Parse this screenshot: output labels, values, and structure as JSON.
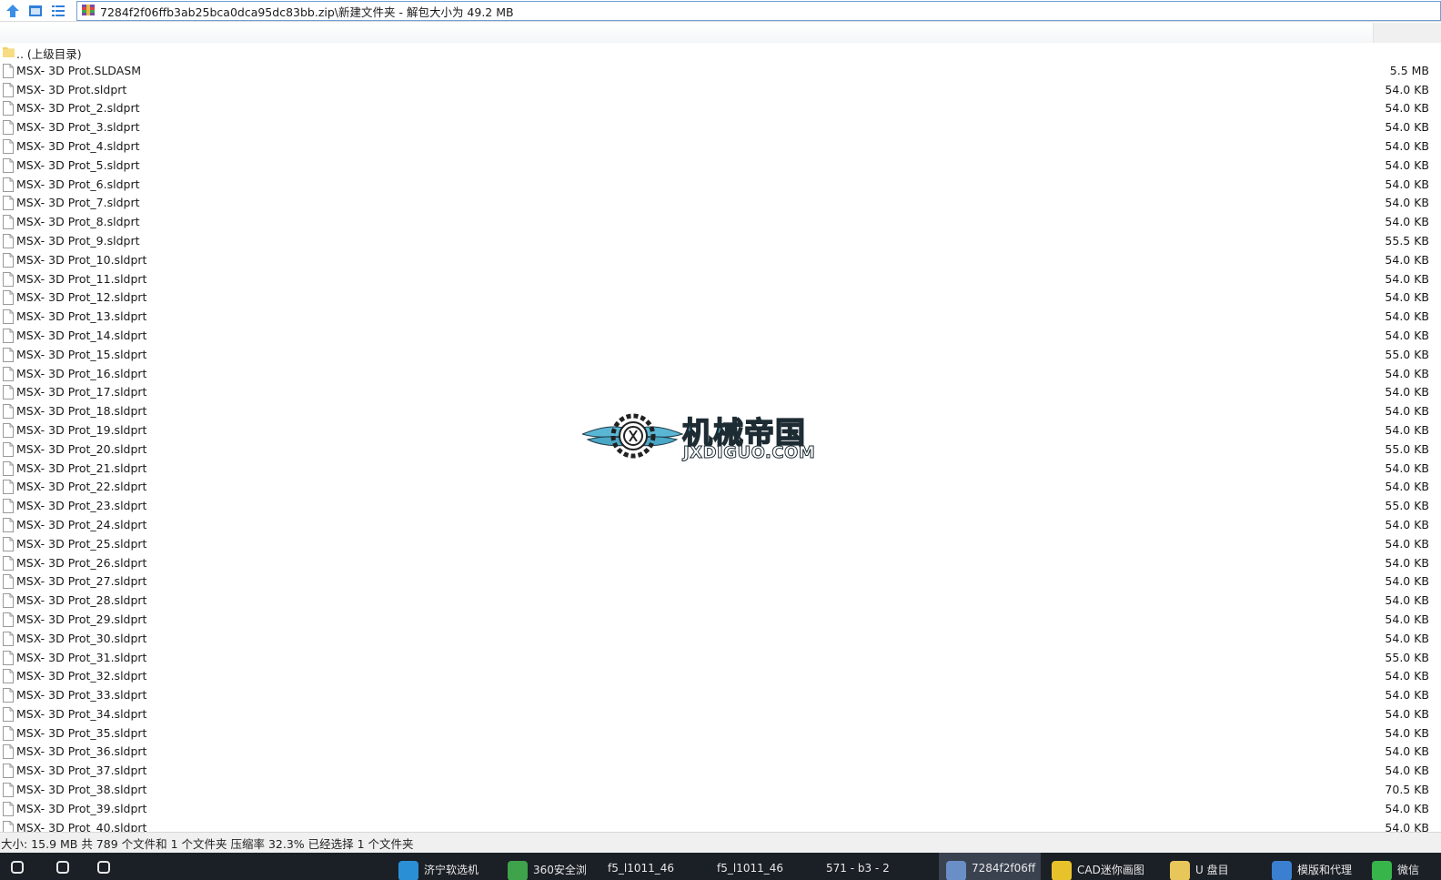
{
  "toolbar": {
    "up_icon": "up-arrow-icon",
    "view_icon": "window-icon",
    "details_icon": "details-list-icon",
    "address": "7284f2f06ffb3ab25bca0dca95dc83bb.zip\\新建文件夹 - 解包大小为 49.2 MB"
  },
  "parent_entry": {
    "label": ".. (上级目录)"
  },
  "files": [
    {
      "name": "MSX- 3D Prot.SLDASM",
      "size": "5.5 MB"
    },
    {
      "name": "MSX- 3D Prot.sldprt",
      "size": "54.0 KB"
    },
    {
      "name": "MSX- 3D Prot_2.sldprt",
      "size": "54.0 KB"
    },
    {
      "name": "MSX- 3D Prot_3.sldprt",
      "size": "54.0 KB"
    },
    {
      "name": "MSX- 3D Prot_4.sldprt",
      "size": "54.0 KB"
    },
    {
      "name": "MSX- 3D Prot_5.sldprt",
      "size": "54.0 KB"
    },
    {
      "name": "MSX- 3D Prot_6.sldprt",
      "size": "54.0 KB"
    },
    {
      "name": "MSX- 3D Prot_7.sldprt",
      "size": "54.0 KB"
    },
    {
      "name": "MSX- 3D Prot_8.sldprt",
      "size": "54.0 KB"
    },
    {
      "name": "MSX- 3D Prot_9.sldprt",
      "size": "55.5 KB"
    },
    {
      "name": "MSX- 3D Prot_10.sldprt",
      "size": "54.0 KB"
    },
    {
      "name": "MSX- 3D Prot_11.sldprt",
      "size": "54.0 KB"
    },
    {
      "name": "MSX- 3D Prot_12.sldprt",
      "size": "54.0 KB"
    },
    {
      "name": "MSX- 3D Prot_13.sldprt",
      "size": "54.0 KB"
    },
    {
      "name": "MSX- 3D Prot_14.sldprt",
      "size": "54.0 KB"
    },
    {
      "name": "MSX- 3D Prot_15.sldprt",
      "size": "55.0 KB"
    },
    {
      "name": "MSX- 3D Prot_16.sldprt",
      "size": "54.0 KB"
    },
    {
      "name": "MSX- 3D Prot_17.sldprt",
      "size": "54.0 KB"
    },
    {
      "name": "MSX- 3D Prot_18.sldprt",
      "size": "54.0 KB"
    },
    {
      "name": "MSX- 3D Prot_19.sldprt",
      "size": "54.0 KB"
    },
    {
      "name": "MSX- 3D Prot_20.sldprt",
      "size": "55.0 KB"
    },
    {
      "name": "MSX- 3D Prot_21.sldprt",
      "size": "54.0 KB"
    },
    {
      "name": "MSX- 3D Prot_22.sldprt",
      "size": "54.0 KB"
    },
    {
      "name": "MSX- 3D Prot_23.sldprt",
      "size": "55.0 KB"
    },
    {
      "name": "MSX- 3D Prot_24.sldprt",
      "size": "54.0 KB"
    },
    {
      "name": "MSX- 3D Prot_25.sldprt",
      "size": "54.0 KB"
    },
    {
      "name": "MSX- 3D Prot_26.sldprt",
      "size": "54.0 KB"
    },
    {
      "name": "MSX- 3D Prot_27.sldprt",
      "size": "54.0 KB"
    },
    {
      "name": "MSX- 3D Prot_28.sldprt",
      "size": "54.0 KB"
    },
    {
      "name": "MSX- 3D Prot_29.sldprt",
      "size": "54.0 KB"
    },
    {
      "name": "MSX- 3D Prot_30.sldprt",
      "size": "54.0 KB"
    },
    {
      "name": "MSX- 3D Prot_31.sldprt",
      "size": "55.0 KB"
    },
    {
      "name": "MSX- 3D Prot_32.sldprt",
      "size": "54.0 KB"
    },
    {
      "name": "MSX- 3D Prot_33.sldprt",
      "size": "54.0 KB"
    },
    {
      "name": "MSX- 3D Prot_34.sldprt",
      "size": "54.0 KB"
    },
    {
      "name": "MSX- 3D Prot_35.sldprt",
      "size": "54.0 KB"
    },
    {
      "name": "MSX- 3D Prot_36.sldprt",
      "size": "54.0 KB"
    },
    {
      "name": "MSX- 3D Prot_37.sldprt",
      "size": "54.0 KB"
    },
    {
      "name": "MSX- 3D Prot_38.sldprt",
      "size": "70.5 KB"
    },
    {
      "name": "MSX- 3D Prot_39.sldprt",
      "size": "54.0 KB"
    },
    {
      "name": "MSX- 3D Prot_40.sldprt",
      "size": "54.0 KB"
    }
  ],
  "status": {
    "text": "大小: 15.9 MB 共 789 个文件和 1 个文件夹 压缩率 32.3% 已经选择 1 个文件夹"
  },
  "watermark": {
    "title": "机械帝国",
    "domain": "JXDIGUO.COM"
  },
  "taskbar": {
    "items": [
      {
        "label": "",
        "icon": "windows-start-icon",
        "color": "#e8e8e8"
      },
      {
        "label": "",
        "icon": "search-icon",
        "color": "#e8e8e8"
      },
      {
        "label": "",
        "icon": "task-view-icon",
        "color": "#e8e8e8"
      },
      {
        "label": "济宁软选机",
        "icon": "app-icon",
        "color": "#2b8fd6"
      },
      {
        "label": "360安全浏",
        "icon": "browser-icon",
        "color": "#3ea34a"
      },
      {
        "label": "f5_l1011_46",
        "icon": "",
        "color": ""
      },
      {
        "label": "f5_l1011_46",
        "icon": "",
        "color": ""
      },
      {
        "label": "571 - b3 - 2",
        "icon": "",
        "color": ""
      },
      {
        "label": "7284f2f06ff",
        "icon": "archive-icon",
        "color": "#6a8fc7"
      },
      {
        "label": "CAD迷你画图",
        "icon": "cad-icon",
        "color": "#e8c22a"
      },
      {
        "label": "U 盘目",
        "icon": "folder-icon",
        "color": "#e8c75a"
      },
      {
        "label": "模版和代理",
        "icon": "ie-icon",
        "color": "#3a7fd0"
      },
      {
        "label": "微信",
        "icon": "wechat-icon",
        "color": "#38b54a"
      }
    ]
  },
  "colors": {
    "accent": "#6f9fd8",
    "taskbar": "#1b1f26",
    "statusbar": "#f0f0f0",
    "watermark_blue": "#57b8d6"
  }
}
